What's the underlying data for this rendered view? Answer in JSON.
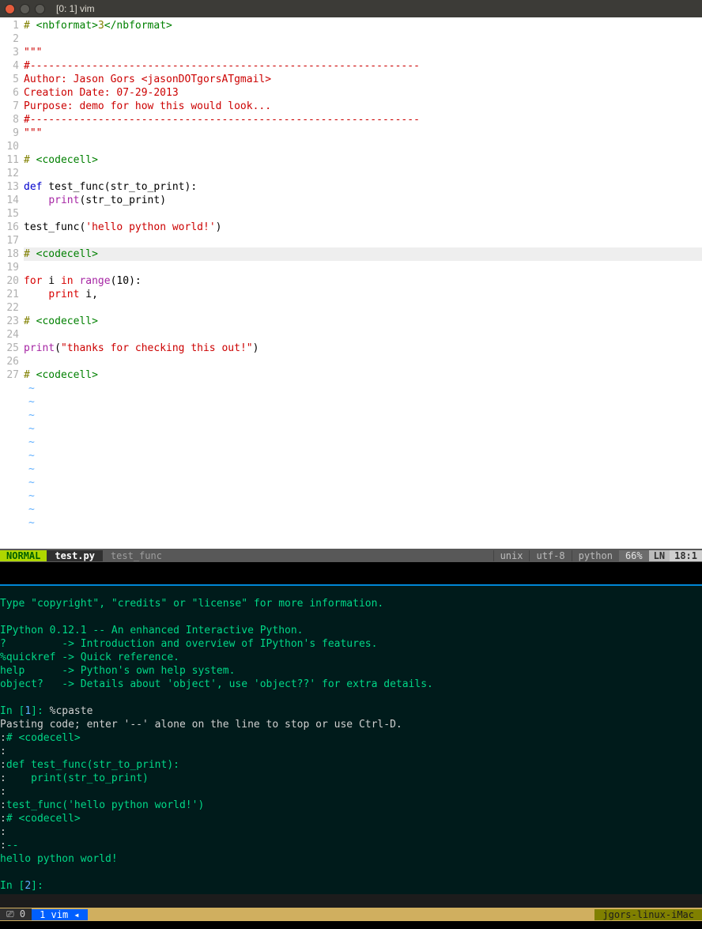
{
  "window": {
    "title": "[0: 1] vim"
  },
  "editor": {
    "lines": [
      {
        "n": 1,
        "segs": [
          {
            "c": "c-olive",
            "t": "# "
          },
          {
            "c": "c-green",
            "t": "<nbformat>"
          },
          {
            "c": "c-olive",
            "t": "3"
          },
          {
            "c": "c-green",
            "t": "</nbformat>"
          }
        ]
      },
      {
        "n": 2,
        "segs": []
      },
      {
        "n": 3,
        "segs": [
          {
            "c": "c-red",
            "t": "\"\"\""
          }
        ]
      },
      {
        "n": 4,
        "segs": [
          {
            "c": "c-red",
            "t": "#---------------------------------------------------------------"
          }
        ]
      },
      {
        "n": 5,
        "segs": [
          {
            "c": "c-red",
            "t": "Author: Jason Gors <jasonDOTgorsATgmail>"
          }
        ]
      },
      {
        "n": 6,
        "segs": [
          {
            "c": "c-red",
            "t": "Creation Date: 07-29-2013"
          }
        ]
      },
      {
        "n": 7,
        "segs": [
          {
            "c": "c-red",
            "t": "Purpose: demo for how this would look..."
          }
        ]
      },
      {
        "n": 8,
        "segs": [
          {
            "c": "c-red",
            "t": "#---------------------------------------------------------------"
          }
        ]
      },
      {
        "n": 9,
        "segs": [
          {
            "c": "c-red",
            "t": "\"\"\""
          }
        ]
      },
      {
        "n": 10,
        "segs": []
      },
      {
        "n": 11,
        "segs": [
          {
            "c": "c-olive",
            "t": "# "
          },
          {
            "c": "c-green",
            "t": "<codecell>"
          }
        ]
      },
      {
        "n": 12,
        "segs": []
      },
      {
        "n": 13,
        "segs": [
          {
            "c": "c-blue",
            "t": "def"
          },
          {
            "c": "",
            "t": " test_func(str_to_print):"
          }
        ]
      },
      {
        "n": 14,
        "segs": [
          {
            "c": "",
            "t": "    "
          },
          {
            "c": "c-purple",
            "t": "print"
          },
          {
            "c": "",
            "t": "(str_to_print)"
          }
        ]
      },
      {
        "n": 15,
        "segs": []
      },
      {
        "n": 16,
        "segs": [
          {
            "c": "",
            "t": "test_func("
          },
          {
            "c": "c-red",
            "t": "'hello python world!'"
          },
          {
            "c": "",
            "t": ")"
          }
        ]
      },
      {
        "n": 17,
        "segs": []
      },
      {
        "n": 18,
        "cursor": true,
        "segs": [
          {
            "c": "c-olive",
            "t": "#"
          },
          {
            "c": "c-olive",
            "t": " "
          },
          {
            "c": "c-green",
            "t": "<codecell>"
          }
        ]
      },
      {
        "n": 19,
        "segs": []
      },
      {
        "n": 20,
        "segs": [
          {
            "c": "c-redk",
            "t": "for"
          },
          {
            "c": "",
            "t": " i "
          },
          {
            "c": "c-redk",
            "t": "in"
          },
          {
            "c": "",
            "t": " "
          },
          {
            "c": "c-purple",
            "t": "range"
          },
          {
            "c": "",
            "t": "(10):"
          }
        ]
      },
      {
        "n": 21,
        "segs": [
          {
            "c": "",
            "t": "    "
          },
          {
            "c": "c-redk",
            "t": "print"
          },
          {
            "c": "",
            "t": " i,"
          }
        ]
      },
      {
        "n": 22,
        "segs": []
      },
      {
        "n": 23,
        "segs": [
          {
            "c": "c-olive",
            "t": "# "
          },
          {
            "c": "c-green",
            "t": "<codecell>"
          }
        ]
      },
      {
        "n": 24,
        "segs": []
      },
      {
        "n": 25,
        "segs": [
          {
            "c": "c-purple",
            "t": "print"
          },
          {
            "c": "",
            "t": "("
          },
          {
            "c": "c-red",
            "t": "\"thanks for checking this out!\""
          },
          {
            "c": "",
            "t": ")"
          }
        ]
      },
      {
        "n": 26,
        "segs": []
      },
      {
        "n": 27,
        "segs": [
          {
            "c": "c-olive",
            "t": "# "
          },
          {
            "c": "c-green",
            "t": "<codecell>"
          }
        ]
      }
    ],
    "tilde_count": 11
  },
  "statusline": {
    "mode": "NORMAL",
    "filename": "test.py",
    "context": "test_func",
    "fileformat": "unix",
    "encoding": "utf-8",
    "filetype": "python",
    "percent": "66%",
    "ln_label": "LN",
    "position": "18:1"
  },
  "terminal": {
    "lines": [
      {
        "segs": [
          {
            "c": "bright",
            "t": "Type \"copyright\", \"credits\" or \"license\" for more information."
          }
        ]
      },
      {
        "segs": [
          {
            "c": "shadow-line",
            "t": "                                                              "
          }
        ]
      },
      {
        "segs": [
          {
            "c": "bright",
            "t": "IPython 0.12.1 -- An enhanced Interactive Python."
          }
        ]
      },
      {
        "segs": [
          {
            "c": "bright",
            "t": "?         -> Introduction and overview of IPython's features."
          }
        ]
      },
      {
        "segs": [
          {
            "c": "bright",
            "t": "%quickref -> Quick reference."
          }
        ]
      },
      {
        "segs": [
          {
            "c": "bright",
            "t": "help      -> Python's own help system."
          }
        ]
      },
      {
        "segs": [
          {
            "c": "bright",
            "t": "object?   -> Details about 'object', use 'object??' for extra details."
          }
        ]
      },
      {
        "segs": [
          {
            "c": "shadow-line",
            "t": "                                                              "
          }
        ]
      },
      {
        "segs": [
          {
            "c": "bright",
            "t": "In ["
          },
          {
            "c": "num",
            "t": "1"
          },
          {
            "c": "bright",
            "t": "]: "
          },
          {
            "c": "white",
            "t": "%cpaste"
          }
        ]
      },
      {
        "segs": [
          {
            "c": "white",
            "t": "Pasting code; enter '--' alone on the line to stop or use Ctrl-D."
          }
        ]
      },
      {
        "segs": [
          {
            "c": "white",
            "t": ":"
          },
          {
            "c": "bright",
            "t": "# <codecell>"
          }
        ]
      },
      {
        "segs": [
          {
            "c": "white",
            "t": ":"
          }
        ]
      },
      {
        "segs": [
          {
            "c": "white",
            "t": ":"
          },
          {
            "c": "bright",
            "t": "def test_func(str_to_print):"
          }
        ]
      },
      {
        "segs": [
          {
            "c": "white",
            "t": ":"
          },
          {
            "c": "bright",
            "t": "    print(str_to_print)"
          }
        ]
      },
      {
        "segs": [
          {
            "c": "white",
            "t": ":"
          }
        ]
      },
      {
        "segs": [
          {
            "c": "white",
            "t": ":"
          },
          {
            "c": "bright",
            "t": "test_func('hello python world!')"
          }
        ]
      },
      {
        "segs": [
          {
            "c": "white",
            "t": ":"
          },
          {
            "c": "bright",
            "t": "# <codecell>"
          }
        ]
      },
      {
        "segs": [
          {
            "c": "white",
            "t": ":"
          }
        ]
      },
      {
        "segs": [
          {
            "c": "white",
            "t": ":"
          },
          {
            "c": "bright",
            "t": "--"
          }
        ]
      },
      {
        "segs": [
          {
            "c": "bright",
            "t": "hello python world!"
          }
        ]
      },
      {
        "segs": [
          {
            "c": "",
            "t": " "
          }
        ]
      },
      {
        "segs": [
          {
            "c": "bright",
            "t": "In ["
          },
          {
            "c": "num",
            "t": "2"
          },
          {
            "c": "bright",
            "t": "]: "
          }
        ]
      }
    ]
  },
  "tmux": {
    "left": "⎚ 0",
    "window": "1  vim ◂",
    "right": "jgors-linux-iMac"
  }
}
